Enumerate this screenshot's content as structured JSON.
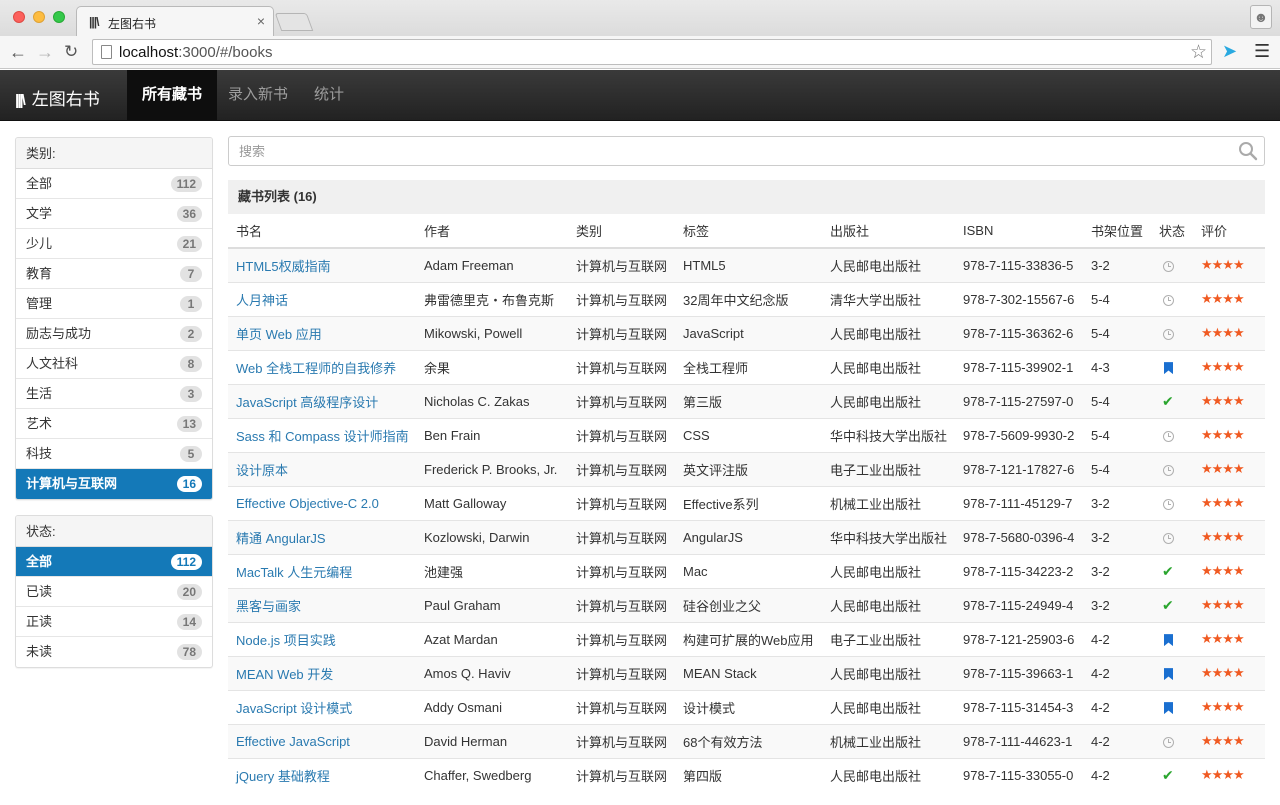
{
  "browser": {
    "tab_title": "左图右书",
    "tab_close": "×",
    "url_host": "localhost",
    "url_path": ":3000/#/books"
  },
  "navbar": {
    "brand": "左图右书",
    "items": [
      {
        "label": "所有藏书",
        "active": true
      },
      {
        "label": "录入新书",
        "active": false
      },
      {
        "label": "统计",
        "active": false
      }
    ]
  },
  "sidebar": {
    "categories": {
      "heading": "类别:",
      "items": [
        {
          "label": "全部",
          "count": "112"
        },
        {
          "label": "文学",
          "count": "36"
        },
        {
          "label": "少儿",
          "count": "21"
        },
        {
          "label": "教育",
          "count": "7"
        },
        {
          "label": "管理",
          "count": "1"
        },
        {
          "label": "励志与成功",
          "count": "2"
        },
        {
          "label": "人文社科",
          "count": "8"
        },
        {
          "label": "生活",
          "count": "3"
        },
        {
          "label": "艺术",
          "count": "13"
        },
        {
          "label": "科技",
          "count": "5"
        },
        {
          "label": "计算机与互联网",
          "count": "16"
        }
      ],
      "active_index": 10
    },
    "status": {
      "heading": "状态:",
      "items": [
        {
          "label": "全部",
          "count": "112"
        },
        {
          "label": "已读",
          "count": "20"
        },
        {
          "label": "正读",
          "count": "14"
        },
        {
          "label": "未读",
          "count": "78"
        }
      ],
      "active_index": 0
    }
  },
  "search": {
    "placeholder": "搜索"
  },
  "book_list": {
    "title": "藏书列表 (16)",
    "columns": [
      "书名",
      "作者",
      "类别",
      "标签",
      "出版社",
      "ISBN",
      "书架位置",
      "状态",
      "评价"
    ],
    "rows": [
      {
        "title": "HTML5权威指南",
        "author": "Adam Freeman",
        "category": "计算机与互联网",
        "tag": "HTML5",
        "publisher": "人民邮电出版社",
        "isbn": "978-7-115-33836-5",
        "shelf": "3-2",
        "status": "clock-icon",
        "rating": 4
      },
      {
        "title": "人月神话",
        "author": "弗雷德里克・布鲁克斯",
        "category": "计算机与互联网",
        "tag": "32周年中文纪念版",
        "publisher": "清华大学出版社",
        "isbn": "978-7-302-15567-6",
        "shelf": "5-4",
        "status": "clock-icon",
        "rating": 4
      },
      {
        "title": "单页 Web 应用",
        "author": "Mikowski, Powell",
        "category": "计算机与互联网",
        "tag": "JavaScript",
        "publisher": "人民邮电出版社",
        "isbn": "978-7-115-36362-6",
        "shelf": "5-4",
        "status": "clock-icon",
        "rating": 4
      },
      {
        "title": "Web 全栈工程师的自我修养",
        "author": "余果",
        "category": "计算机与互联网",
        "tag": "全栈工程师",
        "publisher": "人民邮电出版社",
        "isbn": "978-7-115-39902-1",
        "shelf": "4-3",
        "status": "bookmark-icon",
        "rating": 4
      },
      {
        "title": "JavaScript 高级程序设计",
        "author": "Nicholas C. Zakas",
        "category": "计算机与互联网",
        "tag": "第三版",
        "publisher": "人民邮电出版社",
        "isbn": "978-7-115-27597-0",
        "shelf": "5-4",
        "status": "check-icon",
        "rating": 4
      },
      {
        "title": "Sass 和 Compass 设计师指南",
        "author": "Ben Frain",
        "category": "计算机与互联网",
        "tag": "CSS",
        "publisher": "华中科技大学出版社",
        "isbn": "978-7-5609-9930-2",
        "shelf": "5-4",
        "status": "clock-icon",
        "rating": 4
      },
      {
        "title": "设计原本",
        "author": "Frederick P. Brooks, Jr.",
        "category": "计算机与互联网",
        "tag": "英文评注版",
        "publisher": "电子工业出版社",
        "isbn": "978-7-121-17827-6",
        "shelf": "5-4",
        "status": "clock-icon",
        "rating": 4
      },
      {
        "title": "Effective Objective-C 2.0",
        "author": "Matt Galloway",
        "category": "计算机与互联网",
        "tag": "Effective系列",
        "publisher": "机械工业出版社",
        "isbn": "978-7-111-45129-7",
        "shelf": "3-2",
        "status": "clock-icon",
        "rating": 4
      },
      {
        "title": "精通 AngularJS",
        "author": "Kozlowski, Darwin",
        "category": "计算机与互联网",
        "tag": "AngularJS",
        "publisher": "华中科技大学出版社",
        "isbn": "978-7-5680-0396-4",
        "shelf": "3-2",
        "status": "clock-icon",
        "rating": 4
      },
      {
        "title": "MacTalk 人生元编程",
        "author": "池建强",
        "category": "计算机与互联网",
        "tag": "Mac",
        "publisher": "人民邮电出版社",
        "isbn": "978-7-115-34223-2",
        "shelf": "3-2",
        "status": "check-icon",
        "rating": 4
      },
      {
        "title": "黑客与画家",
        "author": "Paul Graham",
        "category": "计算机与互联网",
        "tag": "硅谷创业之父",
        "publisher": "人民邮电出版社",
        "isbn": "978-7-115-24949-4",
        "shelf": "3-2",
        "status": "check-icon",
        "rating": 4
      },
      {
        "title": "Node.js 项目实践",
        "author": "Azat Mardan",
        "category": "计算机与互联网",
        "tag": "构建可扩展的Web应用",
        "publisher": "电子工业出版社",
        "isbn": "978-7-121-25903-6",
        "shelf": "4-2",
        "status": "bookmark-icon",
        "rating": 4
      },
      {
        "title": "MEAN Web 开发",
        "author": "Amos Q. Haviv",
        "category": "计算机与互联网",
        "tag": "MEAN Stack",
        "publisher": "人民邮电出版社",
        "isbn": "978-7-115-39663-1",
        "shelf": "4-2",
        "status": "bookmark-icon",
        "rating": 4
      },
      {
        "title": "JavaScript 设计模式",
        "author": "Addy Osmani",
        "category": "计算机与互联网",
        "tag": "设计模式",
        "publisher": "人民邮电出版社",
        "isbn": "978-7-115-31454-3",
        "shelf": "4-2",
        "status": "bookmark-icon",
        "rating": 4
      },
      {
        "title": "Effective JavaScript",
        "author": "David Herman",
        "category": "计算机与互联网",
        "tag": "68个有效方法",
        "publisher": "机械工业出版社",
        "isbn": "978-7-111-44623-1",
        "shelf": "4-2",
        "status": "clock-icon",
        "rating": 4
      },
      {
        "title": "jQuery 基础教程",
        "author": "Chaffer, Swedberg",
        "category": "计算机与互联网",
        "tag": "第四版",
        "publisher": "人民邮电出版社",
        "isbn": "978-7-115-33055-0",
        "shelf": "4-2",
        "status": "check-icon",
        "rating": 4
      }
    ]
  },
  "colors": {
    "accent": "#1479b8",
    "link": "#2a7ab0",
    "star": "#f05a22",
    "check": "#2aa52e",
    "bookmark": "#1a6fd0"
  }
}
